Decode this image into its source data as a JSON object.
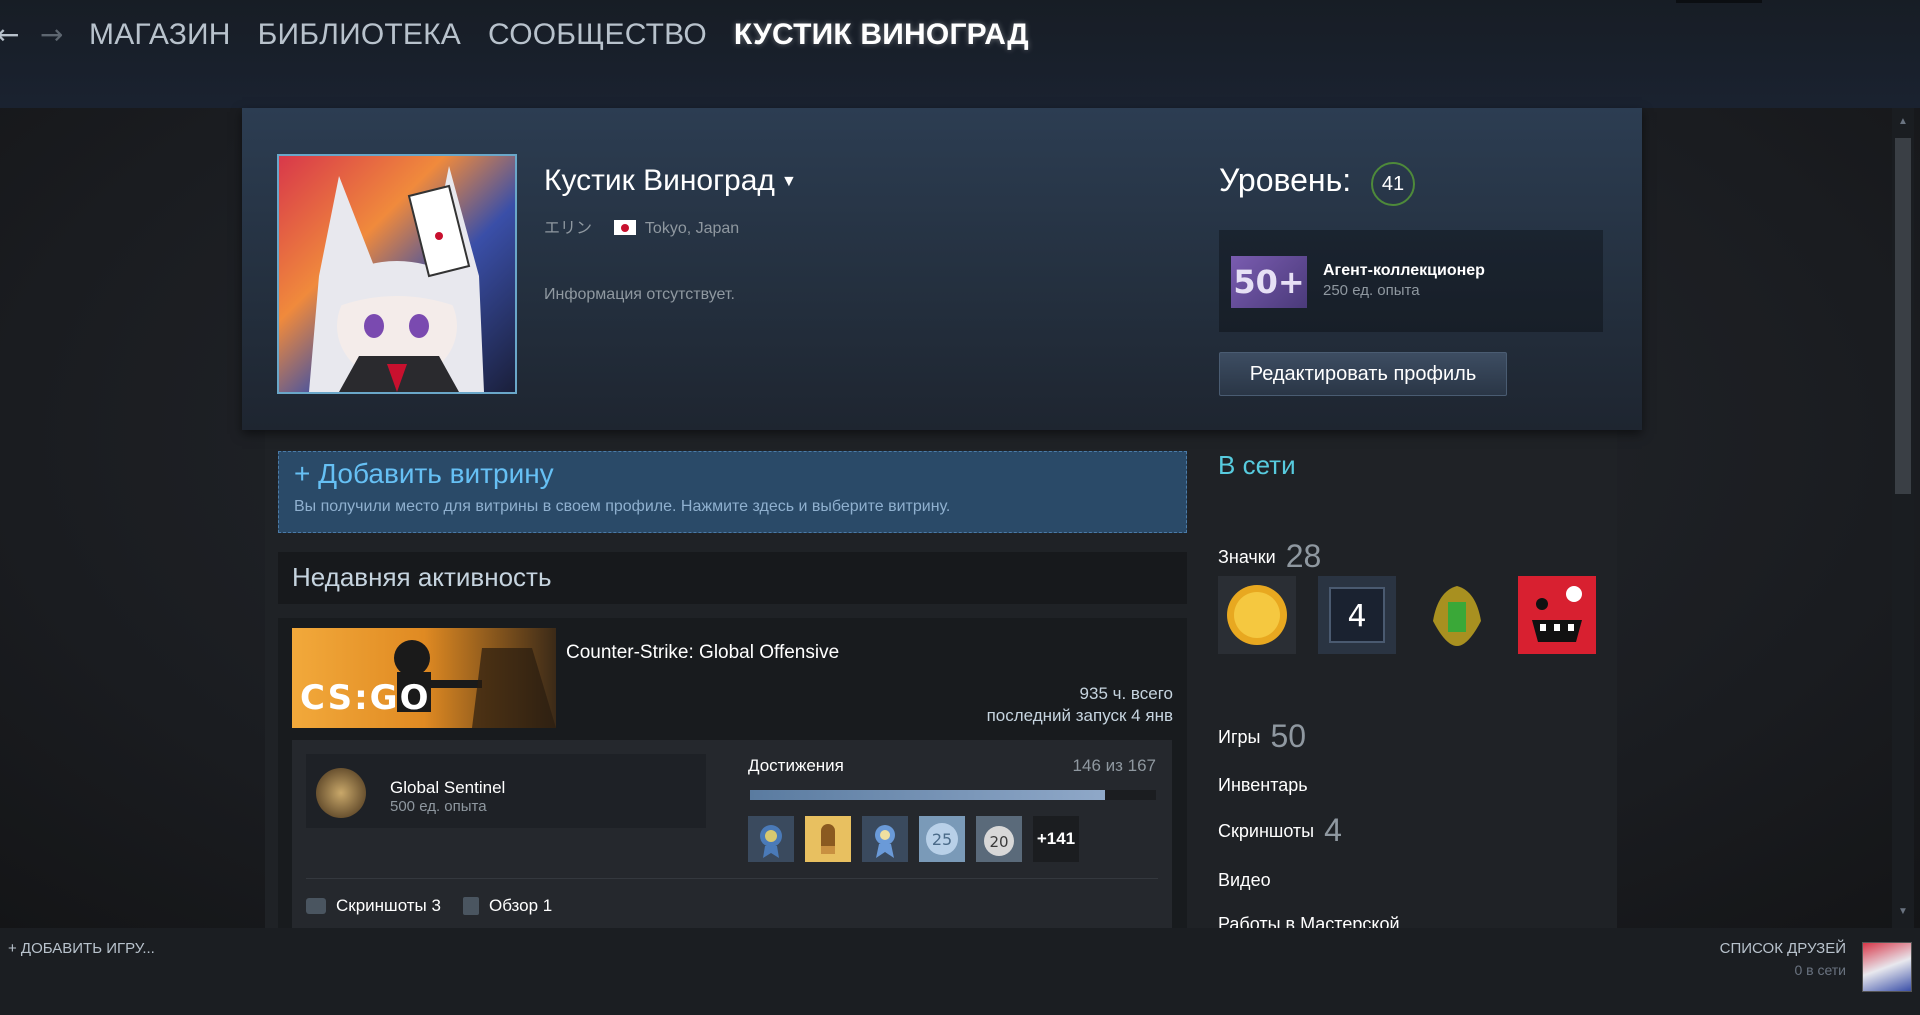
{
  "nav": {
    "back_icon": "arrow-left-icon",
    "forward_icon": "arrow-right-icon",
    "links": [
      "МАГАЗИН",
      "БИБЛИОТЕКА",
      "СООБЩЕСТВО",
      "КУСТИК ВИНОГРАД"
    ]
  },
  "profile": {
    "persona_name": "Кустик Виноград",
    "real_name": "エリン",
    "location": "Tokyo, Japan",
    "summary": "Информация отсутствует.",
    "level_label": "Уровень:",
    "level": "41",
    "favorite_badge": {
      "icon_text": "50+",
      "name": "Агент-коллекционер",
      "xp": "250 ед. опыта"
    },
    "edit_button": "Редактировать профиль"
  },
  "showcase": {
    "title": "+ Добавить витрину",
    "description": "Вы получили место для витрины в своем профиле. Нажмите здесь и выберите витрину."
  },
  "recent": {
    "title": "Недавняя активность",
    "game": {
      "capsule_text": "CS:GO",
      "name": "Counter-Strike: Global Offensive",
      "hours": "935 ч. всего",
      "last_played": "последний запуск 4 янв"
    },
    "badge": {
      "name": "Global Sentinel",
      "xp": "500 ед. опыта"
    },
    "achievements": {
      "label": "Достижения",
      "count": "146 из 167",
      "unlocked": 146,
      "total": 167,
      "more": "+141"
    },
    "footer": {
      "screenshots": "Скриншоты 3",
      "reviews": "Обзор 1"
    }
  },
  "sidebar": {
    "status": "В сети",
    "badges_label": "Значки",
    "badges_count": "28",
    "badge_level_number": "4",
    "games_label": "Игры",
    "games_count": "50",
    "inventory_label": "Инвентарь",
    "screenshots_label": "Скриншоты",
    "screenshots_count": "4",
    "videos_label": "Видео",
    "workshop_label": "Работы в Мастерской"
  },
  "bottom": {
    "add_game": "+  ДОБАВИТЬ ИГРУ...",
    "friends_label": "СПИСОК ДРУЗЕЙ",
    "friends_online": "0 в сети"
  },
  "colors": {
    "accent_blue": "#66c0f4",
    "online_teal": "#57cbde",
    "level_ring": "#4e8a3a"
  }
}
